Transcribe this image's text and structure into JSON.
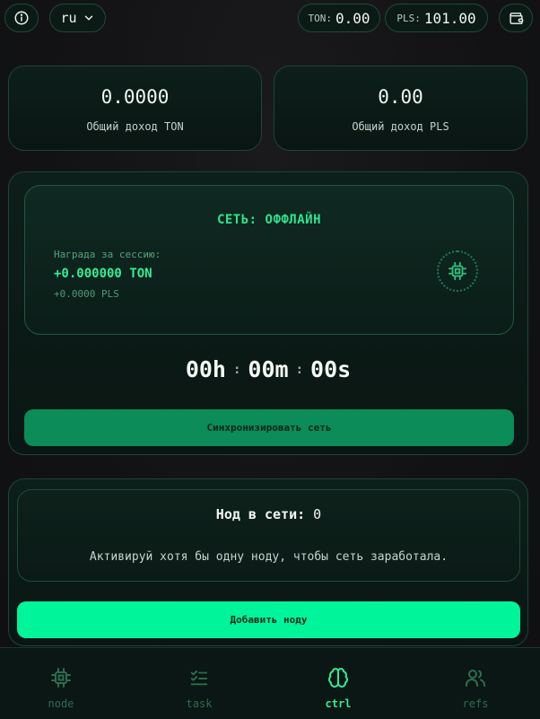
{
  "header": {
    "language": "ru",
    "balances": [
      {
        "label": "TON:",
        "value": "0.00"
      },
      {
        "label": "PLS:",
        "value": "101.00"
      }
    ]
  },
  "stats": [
    {
      "value": "0.0000",
      "label": "Общий доход TON"
    },
    {
      "value": "0.00",
      "label": "Общий доход PLS"
    }
  ],
  "network": {
    "status": "СЕТЬ: ОФФЛАЙН",
    "reward_label": "Награда за сессию:",
    "reward_ton": "+0.000000 TON",
    "reward_pls": "+0.0000 PLS",
    "timer": {
      "hours": "00h",
      "minutes": "00m",
      "seconds": "00s",
      "separator": ":"
    },
    "sync_label": "Синхронизировать сеть"
  },
  "nodes": {
    "title": "Нод в сети:",
    "count": "0",
    "description": "Активируй хотя бы одну ноду, чтобы сеть заработала.",
    "add_label": "Добавить ноду"
  },
  "nav": {
    "items": [
      {
        "label": "node",
        "icon": "chip-icon",
        "active": false
      },
      {
        "label": "task",
        "icon": "checklist-icon",
        "active": false
      },
      {
        "label": "ctrl",
        "icon": "brain-icon",
        "active": true
      },
      {
        "label": "refs",
        "icon": "users-icon",
        "active": false
      }
    ]
  },
  "colors": {
    "accent": "#00f59a",
    "accent_dark": "#0b8c58",
    "status_green": "#2ee58f",
    "background": "#121214"
  }
}
